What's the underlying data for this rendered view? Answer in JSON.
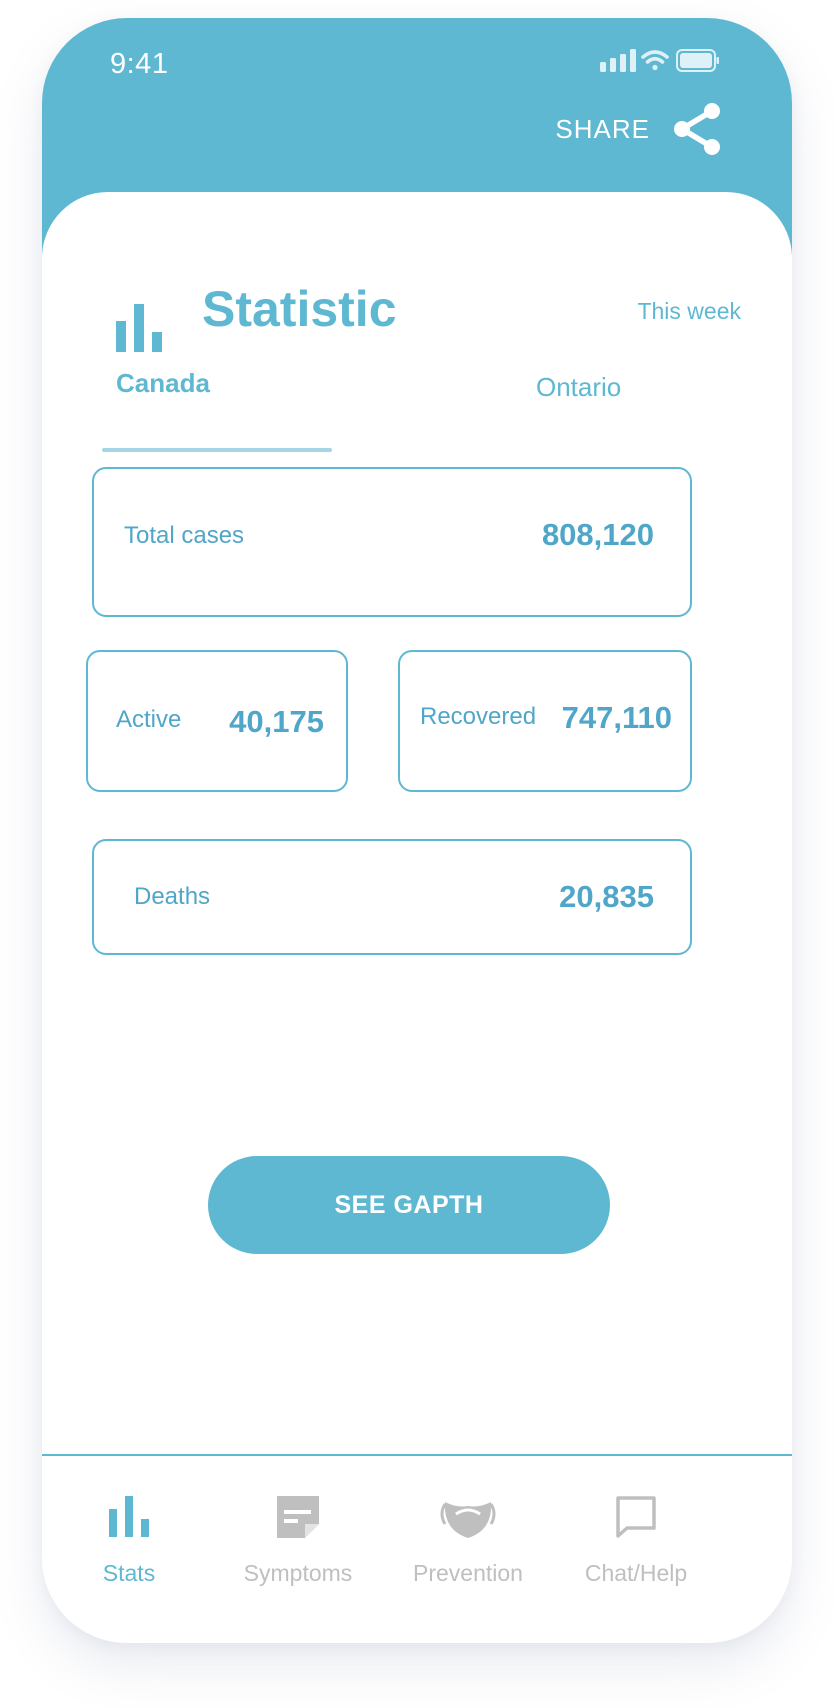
{
  "status_bar": {
    "time": "9:41"
  },
  "header": {
    "share_label": "SHARE"
  },
  "statistic": {
    "title": "Statistic",
    "period": "This week",
    "tabs": [
      {
        "label": "Canada",
        "active": true
      },
      {
        "label": "Ontario",
        "active": false
      }
    ]
  },
  "stats": {
    "total_cases": {
      "label": "Total cases",
      "value": "808,120"
    },
    "active": {
      "label": "Active",
      "value": "40,175"
    },
    "recovered": {
      "label": "Recovered",
      "value": "747,110"
    },
    "deaths": {
      "label": "Deaths",
      "value": "20,835"
    }
  },
  "see_graph_button": "SEE GAPTH",
  "bottom_nav": [
    {
      "label": "Stats",
      "icon": "bar-chart-icon",
      "active": true
    },
    {
      "label": "Symptoms",
      "icon": "note-icon",
      "active": false
    },
    {
      "label": "Prevention",
      "icon": "mask-icon",
      "active": false
    },
    {
      "label": "Chat/Help",
      "icon": "chat-bubble-icon",
      "active": false
    }
  ],
  "colors": {
    "primary": "#5fb8d1",
    "text_accent": "#4fa6c8",
    "inactive_nav": "#bfbfbf",
    "tab_underline": "#a6d6e6"
  }
}
